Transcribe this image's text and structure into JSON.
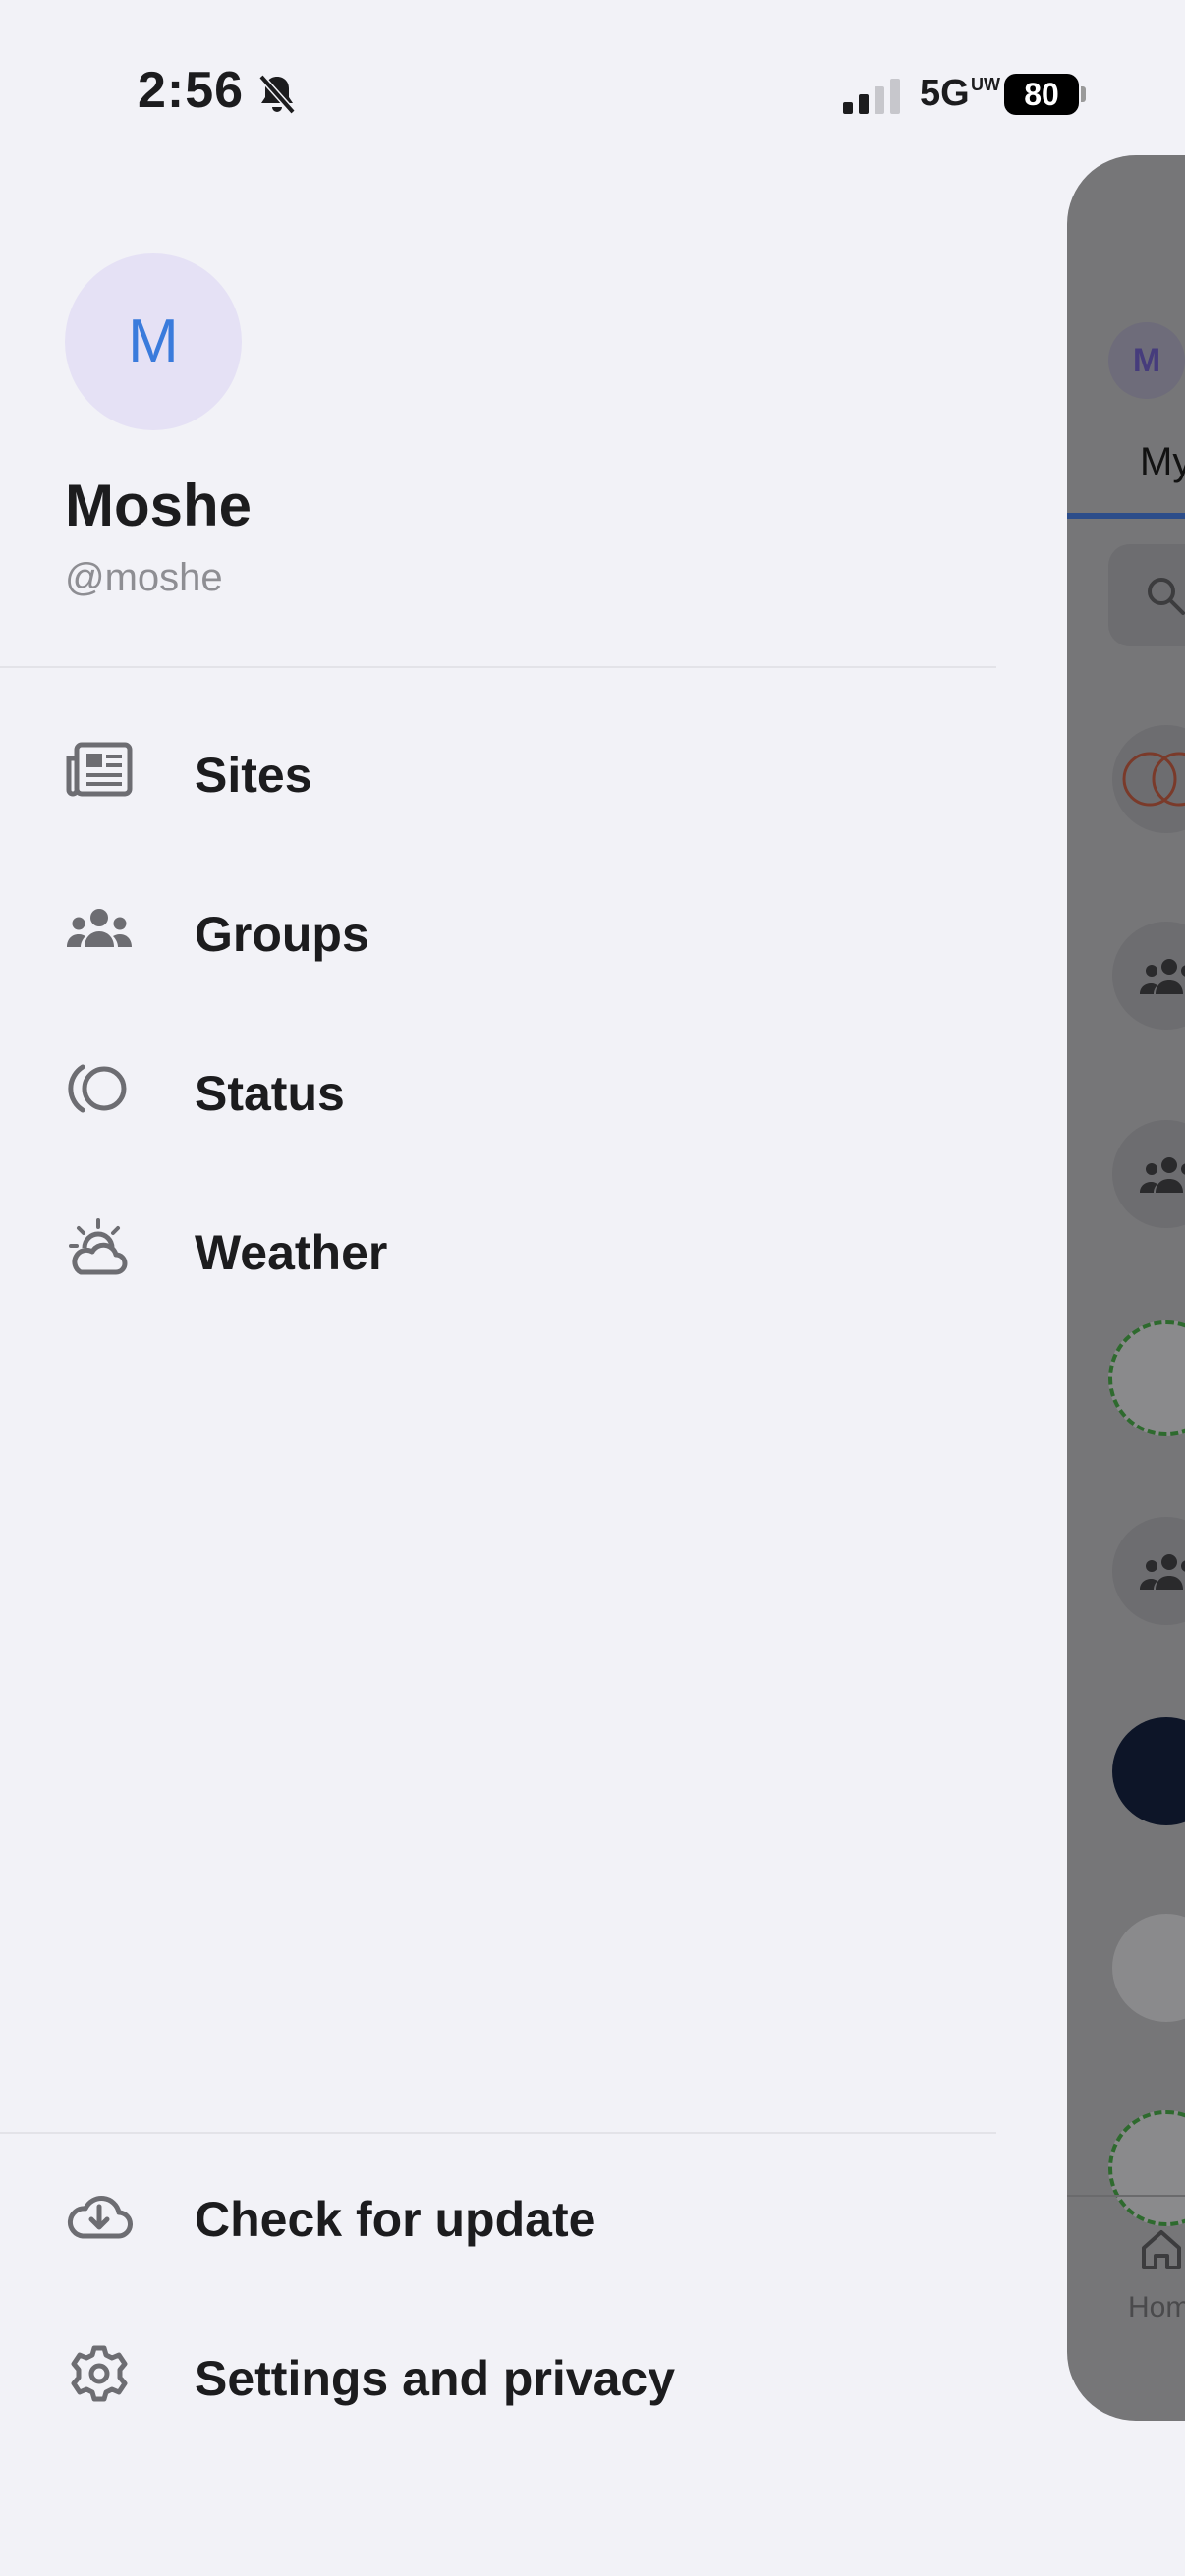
{
  "status_bar": {
    "time": "2:56",
    "network": "5G",
    "network_badge": "UW",
    "battery": "80"
  },
  "profile": {
    "avatar_letter": "M",
    "name": "Moshe",
    "handle": "@moshe"
  },
  "menu": [
    {
      "label": "Sites",
      "icon": "newspaper-icon"
    },
    {
      "label": "Groups",
      "icon": "groups-icon"
    },
    {
      "label": "Status",
      "icon": "status-icon"
    },
    {
      "label": "Weather",
      "icon": "weather-icon"
    }
  ],
  "footer_menu": [
    {
      "label": "Check for update",
      "icon": "cloud-download-icon"
    },
    {
      "label": "Settings and privacy",
      "icon": "gear-icon"
    }
  ],
  "background_screen": {
    "avatar_letter": "M",
    "tab_label": "My",
    "nav_home_label": "Hom"
  },
  "colors": {
    "background": "#f2f2f7",
    "accent": "#3a7bdc",
    "avatar_bg": "#e5e1f5",
    "overlay": "#767678"
  }
}
